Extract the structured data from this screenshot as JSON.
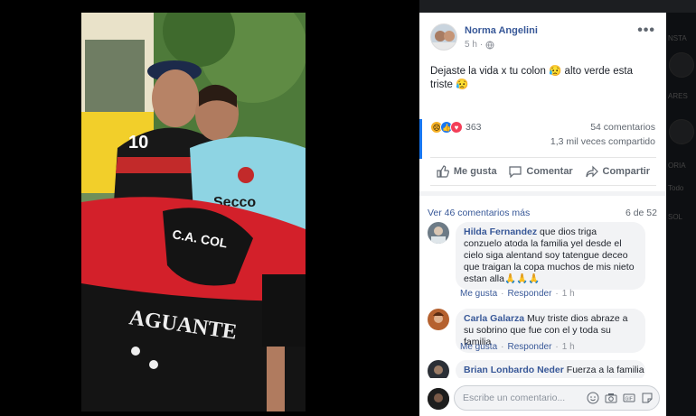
{
  "post": {
    "author": "Norma Angelini",
    "time": "5 h",
    "text": "Dejaste la vida x tu colon 😥 alto verde esta triste 😥",
    "reaction_count": "363",
    "comments_count": "54 comentarios",
    "shares_count": "1,3 mil veces compartido",
    "more_label": "•••"
  },
  "photo": {
    "jersey_number": "10",
    "flag_text_top": "C.A. COL",
    "flag_text_bottom": "AGUANTE",
    "sponsor_text": "Secco"
  },
  "actions": {
    "like": "Me gusta",
    "comment": "Comentar",
    "share": "Compartir"
  },
  "comments_section": {
    "view_more": "Ver 46 comentarios más",
    "pager": "6 de 52",
    "items": [
      {
        "name": "Hilda Fernandez",
        "text": "que dios triga conzuelo atoda la familia yel desde el cielo siga alentand soy tatengue deceo que traigan la copa muchos de mis nieto estan alla🙏🙏🙏",
        "like": "Me gusta",
        "reply": "Responder",
        "time": "1 h"
      },
      {
        "name": "Carla Galarza",
        "text": "Muy triste dios abraze a su sobrino que fue con el y toda su familia",
        "like": "Me gusta",
        "reply": "Responder",
        "time": "1 h"
      },
      {
        "name": "Brian Lonbardo Neder",
        "text": "Fuerza a la familia"
      }
    ]
  },
  "composer": {
    "placeholder": "Escribe un comentario..."
  },
  "colors": {
    "link": "#385898",
    "like_blue": "#1877f2",
    "club_red": "#d3202a",
    "club_black": "#111111"
  }
}
